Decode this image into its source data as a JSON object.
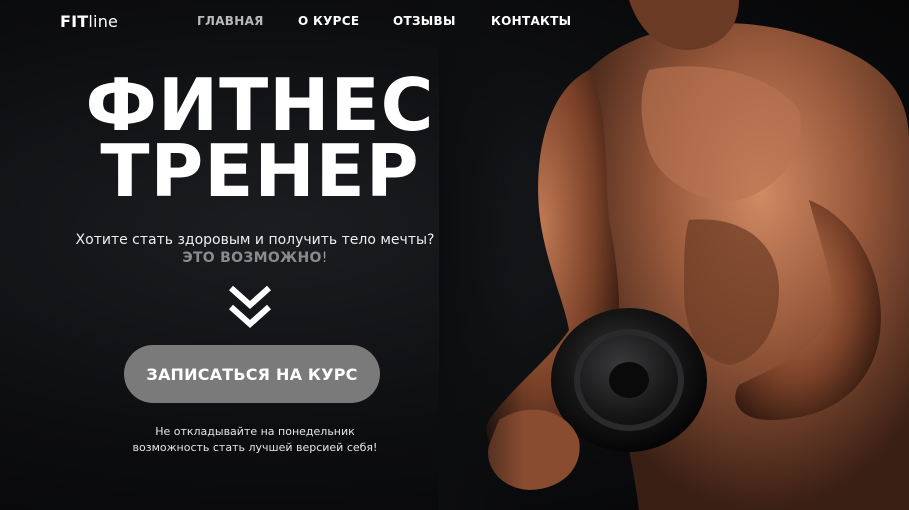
{
  "brand": {
    "logo_strong": "FIT",
    "logo_light": "line"
  },
  "nav": {
    "items": [
      {
        "label": "ГЛАВНАЯ",
        "active": true
      },
      {
        "label": "О КУРСЕ",
        "active": false
      },
      {
        "label": "ОТЗЫВЫ",
        "active": false
      },
      {
        "label": "КОНТАКТЫ",
        "active": false
      }
    ]
  },
  "hero": {
    "title_line1": "ФИТНЕС",
    "title_line2": "ТРЕНЕР",
    "subtitle": "Хотите стать здоровым и получить тело мечты?",
    "emphasis": "ЭТО ВОЗМОЖНО",
    "emphasis_suffix": "!",
    "cta_label": "ЗАПИСАТЬСЯ НА КУРС",
    "note_line1": "Не откладывайте на понедельник",
    "note_line2": "возможность стать лучшей версией себя!"
  },
  "icons": {
    "scroll": "double-chevron-down-icon",
    "photo": "athlete-with-dumbbell-photo"
  },
  "colors": {
    "background": "#0c0d0f",
    "text": "#ffffff",
    "nav_active": "#b9b9b9",
    "emphasis": "#8b8b8b",
    "button": "#7a7a7a"
  }
}
